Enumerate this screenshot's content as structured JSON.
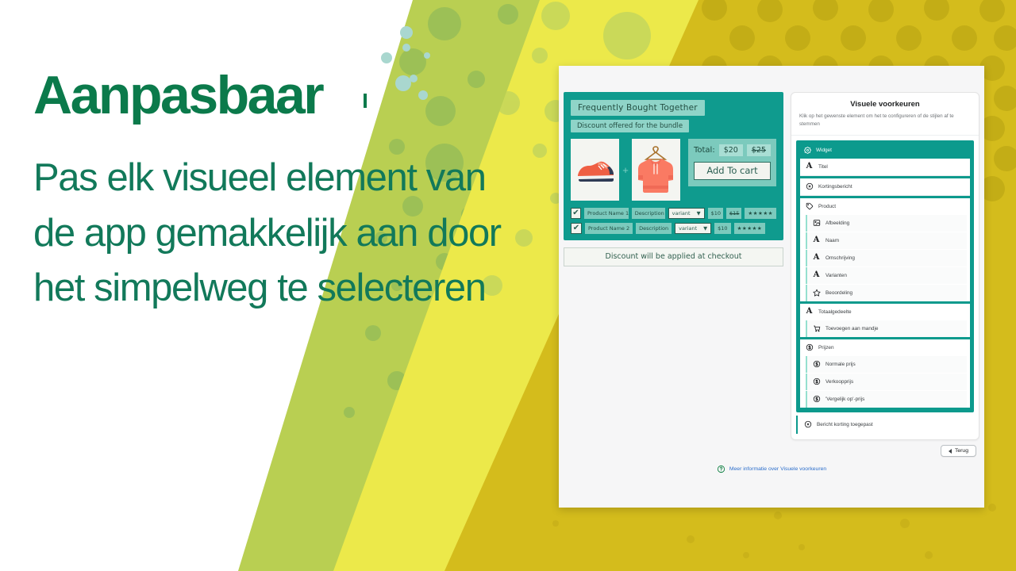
{
  "slide": {
    "headline": "Aanpasbaar",
    "subcopy": "Pas elk visueel element van de app gemakkelijk aan door het simpelweg te selecteren",
    "brand_green": "#0b7a4b",
    "brand_teal": "#0c9a8d",
    "accent_gold": "#d4b81c",
    "accent_lime": "#b6cf4c"
  },
  "widget_preview": {
    "title": "Frequently Bought Together",
    "subtitle": "Discount offered for the bundle",
    "images": [
      {
        "name": "running-shoe-image",
        "alt": "red running shoe"
      },
      {
        "name": "hoodie-image",
        "alt": "coral hoodie on hanger"
      }
    ],
    "plus_symbol": "+",
    "total_label": "Total:",
    "total_price": "$20",
    "total_compare_price": "$25",
    "add_to_cart_label": "Add To cart",
    "footer_note": "Discount will be applied at checkout",
    "products": [
      {
        "checked": "✔",
        "name": "Product Name 1",
        "description": "Description",
        "variant": "variant",
        "variant_caret": "▼",
        "price": "$10",
        "compare_price": "$15",
        "rating": "★★★★★"
      },
      {
        "checked": "✔",
        "name": "Product Name 2",
        "description": "Description",
        "variant": "variant",
        "variant_caret": "▼",
        "price": "$10",
        "compare_price": "",
        "rating": "★★★★★"
      }
    ]
  },
  "visual_preferences": {
    "title": "Visuele voorkeuren",
    "description": "Klik op het gewenste element om het te configureren of de stijlen af te stemmen",
    "widget_label": "Widget",
    "widget_icon": "gear-icon",
    "groups": [
      {
        "id": "titel",
        "label": "Titel",
        "icon": "letter-a-icon",
        "children": []
      },
      {
        "id": "kortingsbericht",
        "label": "Kortingsbericht",
        "icon": "discount-badge-icon",
        "children": []
      },
      {
        "id": "product",
        "label": "Product",
        "icon": "tag-icon",
        "children": [
          {
            "id": "afbeelding",
            "label": "Afbeelding",
            "icon": "image-icon"
          },
          {
            "id": "naam",
            "label": "Naam",
            "icon": "letter-a-icon"
          },
          {
            "id": "omschrijving",
            "label": "Omschrijving",
            "icon": "letter-a-icon"
          },
          {
            "id": "varianten",
            "label": "Varianten",
            "icon": "letter-a-icon"
          },
          {
            "id": "beoordeling",
            "label": "Beoordeling",
            "icon": "star-icon"
          }
        ]
      },
      {
        "id": "totaalgedeelte",
        "label": "Totaalgedeelte",
        "icon": "letter-a-icon",
        "children": [
          {
            "id": "toevoegen-aan-mandje",
            "label": "Toevoegen aan mandje",
            "icon": "cart-icon"
          }
        ]
      },
      {
        "id": "prijzen",
        "label": "Prijzen",
        "icon": "dollar-icon",
        "children": [
          {
            "id": "normale-prijs",
            "label": "Normale prijs",
            "icon": "dollar-icon"
          },
          {
            "id": "verkoopprijs",
            "label": "Verkoopprijs",
            "icon": "dollar-icon"
          },
          {
            "id": "vergelijk-op-prijs",
            "label": "'Vergelijk op'-prijs",
            "icon": "dollar-icon"
          }
        ]
      }
    ],
    "applied_message": {
      "label": "Bericht korting toegepast",
      "icon": "discount-badge-icon"
    },
    "back_button": "Terug",
    "more_info_link": "Meer informatie over Visuele voorkeuren",
    "more_info_icon": "question-circle-icon"
  }
}
